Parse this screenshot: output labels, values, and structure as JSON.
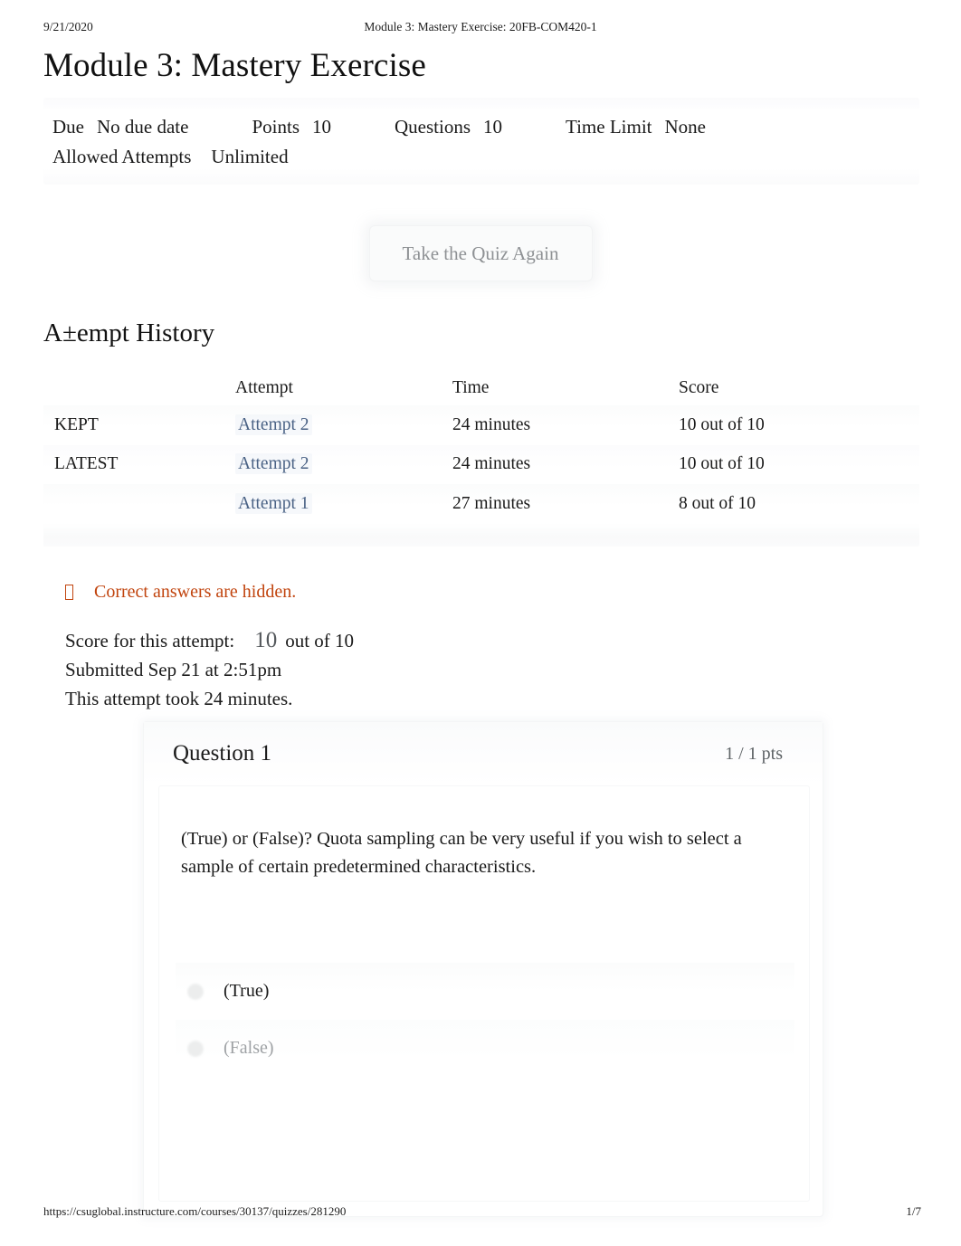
{
  "print_header": {
    "date": "9/21/2020",
    "document_title": "Module 3: Mastery Exercise: 20FB-COM420-1"
  },
  "page_title": "Module 3: Mastery Exercise",
  "quiz_meta": {
    "due_label": "Due",
    "due_value": "No due date",
    "points_label": "Points",
    "points_value": "10",
    "questions_label": "Questions",
    "questions_value": "10",
    "time_limit_label": "Time Limit",
    "time_limit_value": "None",
    "allowed_attempts_label": "Allowed Attempts",
    "allowed_attempts_value": "Unlimited"
  },
  "retake_button": {
    "label": "Take the Quiz Again"
  },
  "attempt_history": {
    "heading": "A±empt History",
    "columns": [
      "",
      "Attempt",
      "Time",
      "Score"
    ],
    "rows": [
      {
        "tag": "KEPT",
        "attempt": "Attempt 2",
        "time": "24 minutes",
        "score": "10 out of 10"
      },
      {
        "tag": "LATEST",
        "attempt": "Attempt 2",
        "time": "24 minutes",
        "score": "10 out of 10"
      },
      {
        "tag": "",
        "attempt": "Attempt 1",
        "time": "27 minutes",
        "score": "8 out of 10"
      }
    ]
  },
  "warning": {
    "icon": "missing-glyph-box",
    "text": "Correct answers are hidden.",
    "color": "#c1440e"
  },
  "score_summary": {
    "score_label": "Score for this attempt:",
    "score_value": "10",
    "score_out_of": "out of 10",
    "submitted": "Submitted Sep 21 at 2:51pm",
    "duration": "This attempt took 24 minutes."
  },
  "question": {
    "title": "Question 1",
    "points": "1 / 1 pts",
    "text": "(True) or (False)? Quota sampling can be very useful if you wish to select a sample of certain predetermined characteristics.",
    "answers": [
      {
        "label": "(True)",
        "state": "selected"
      },
      {
        "label": "(False)",
        "state": "unselected"
      }
    ]
  },
  "print_footer": {
    "url": "https://csuglobal.instructure.com/courses/30137/quizzes/281290",
    "page": "1/7"
  },
  "colors": {
    "link": "#4a6285",
    "warning": "#c1440e",
    "text": "#1a1a1a",
    "muted": "#9fa2a5"
  }
}
